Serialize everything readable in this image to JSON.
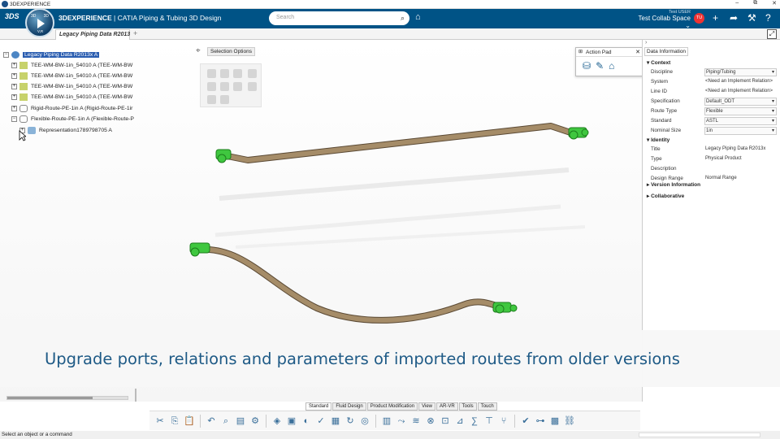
{
  "os_bar": {
    "title": "3DEXPERIENCE",
    "controls": [
      "–",
      "⧉",
      "✕"
    ]
  },
  "header": {
    "brand_bold": "3DEXPERIENCE",
    "brand_rest": " | CATIA  Piping & Tubing 3D Design",
    "compass": {
      "left": "3D",
      "right": "3D",
      "bottom": "V,R"
    },
    "search_placeholder": "Search",
    "user_small": "Test USER",
    "user_space": "Test Collab Space ⌄",
    "avatar_initials": "TU",
    "accent": "#005386"
  },
  "tab": {
    "label": "Legacy Piping Data R2013",
    "add": "+"
  },
  "tree": {
    "root": "Legacy Piping Data R2013x A",
    "items": [
      "TEE-WM-BW-1in_54010 A (TEE-WM-BW",
      "TEE-WM-BW-1in_54010 A (TEE-WM-BW",
      "TEE-WM-BW-1in_54010 A (TEE-WM-BW",
      "TEE-WM-BW-1in_54010 A (TEE-WM-BW",
      "Rigid-Route-PE-1in A (Rigid-Route-PE-1ir",
      "Flexible-Route-PE-1in A (Flexible-Route-P"
    ],
    "child": "Representation1789798705 A"
  },
  "selection_options": {
    "label": "Selection Options"
  },
  "action_pad": {
    "title": "Action Pad",
    "close": "✕"
  },
  "data_panel": {
    "tab": "Data Information",
    "context_title": "Context",
    "context": [
      {
        "k": "Discipline",
        "v": "Piping/Tubing",
        "dropdown": true
      },
      {
        "k": "System",
        "v": "<Need an Implement Relation>",
        "dropdown": false
      },
      {
        "k": "Line ID",
        "v": "<Need an Implement Relation>",
        "dropdown": false
      },
      {
        "k": "Specification",
        "v": "Default_ODT",
        "dropdown": true
      },
      {
        "k": "Route Type",
        "v": "Flexible",
        "dropdown": true
      },
      {
        "k": "Standard",
        "v": "ASTL",
        "dropdown": true
      },
      {
        "k": "Nominal Size",
        "v": "1in",
        "dropdown": true
      }
    ],
    "identity_title": "Identity",
    "identity": [
      {
        "k": "Title",
        "v": "Legacy Piping Data R2013x"
      },
      {
        "k": "Type",
        "v": "Physical Product"
      },
      {
        "k": "Description",
        "v": ""
      },
      {
        "k": "Design Range",
        "v": "Normal Range"
      }
    ],
    "version_title": "Version Information",
    "collab_title": "Collaborative"
  },
  "caption": "Upgrade ports, relations and parameters of imported routes from older versions",
  "toolbar_tabs": [
    "Standard",
    "Fluid Design",
    "Product Modification",
    "View",
    "AR-VR",
    "Tools",
    "Touch"
  ],
  "toolbar_icons": [
    "scissors-icon",
    "copy-icon",
    "paste-icon",
    "undo-icon",
    "zoom-icon",
    "book-icon",
    "gear-icon",
    "cube-icon",
    "assembly-icon",
    "pipe-icon",
    "check-icon",
    "grid-icon",
    "refresh-icon",
    "bulb-icon",
    "table-icon",
    "route-icon",
    "flow-icon",
    "valve-icon",
    "fit-icon",
    "measure-icon",
    "calc-icon",
    "tee-icon",
    "branch-icon",
    "ok-icon",
    "connect-icon",
    "matrix-icon",
    "link-icon"
  ],
  "status": "Select an object or a command",
  "colors": {
    "pipe": "#a58c68",
    "fitting": "#3fc73f",
    "caption_text": "#1e5a86"
  }
}
